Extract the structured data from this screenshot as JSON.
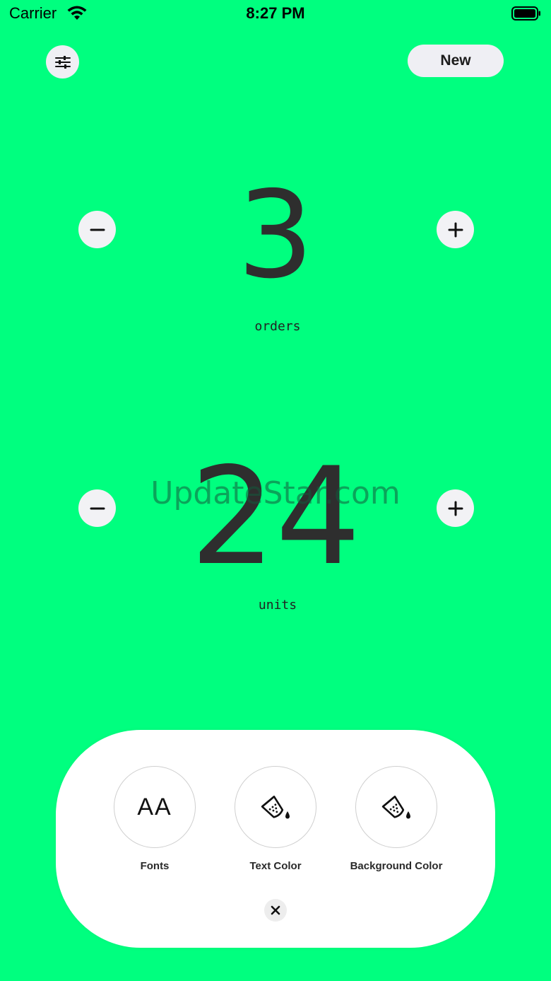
{
  "status_bar": {
    "carrier": "Carrier",
    "time": "8:27 PM"
  },
  "toolbar": {
    "settings_icon": "sliders-icon",
    "new_label": "New"
  },
  "counters": [
    {
      "value": "3",
      "label": "orders"
    },
    {
      "value": "24",
      "label": "units"
    }
  ],
  "watermark": "UpdateStar.com",
  "panel": {
    "options": [
      {
        "label": "Fonts",
        "glyph": "AA",
        "icon": "font-size-icon"
      },
      {
        "label": "Text Color",
        "icon": "paint-bucket-icon"
      },
      {
        "label": "Background Color",
        "icon": "paint-bucket-icon"
      }
    ],
    "close_icon": "close-icon"
  },
  "colors": {
    "background": "#00FF7F",
    "button": "#EFEFF4",
    "counter_text": "#2e2e2e"
  }
}
